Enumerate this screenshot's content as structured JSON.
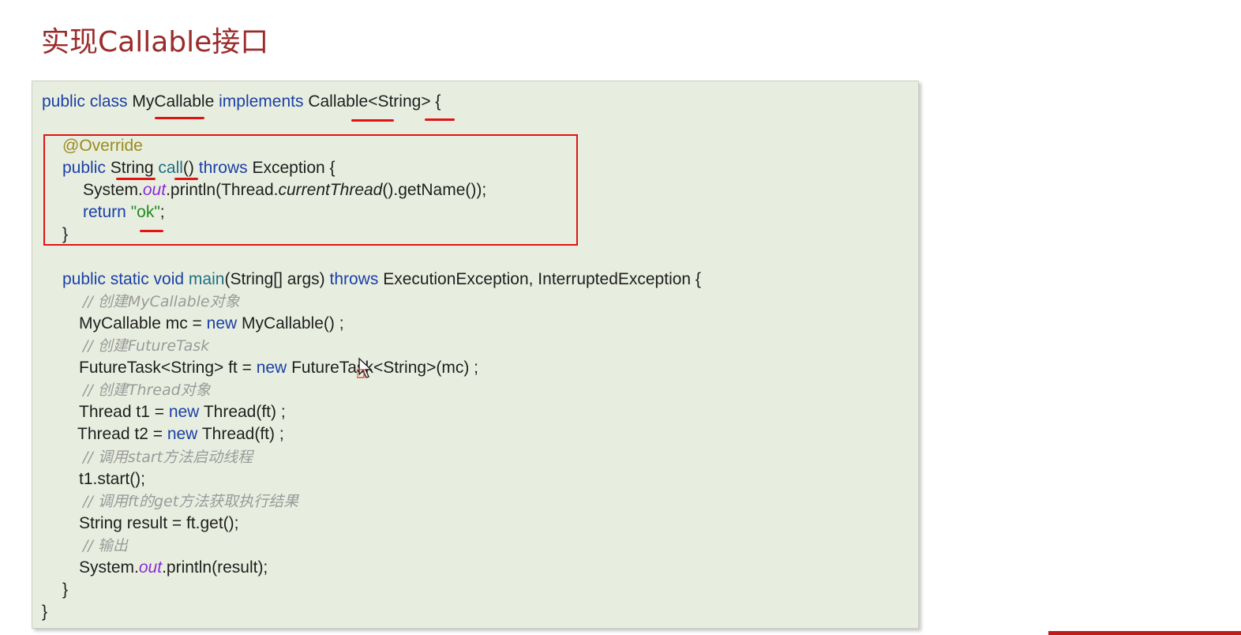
{
  "slide": {
    "title": "实现Callable接口"
  },
  "code": {
    "line1": {
      "kw1": "public class ",
      "name": "MyCallable",
      "kw2": " implements ",
      "type": "Callable",
      "generic": "<String>",
      "tail": " {"
    },
    "line2": {
      "annotation": "@Override"
    },
    "line3": {
      "kw1": "public ",
      "rtype": "String",
      "sp": " ",
      "method": "call",
      "params": "()",
      "kw2": " throws ",
      "exc": "Exception {"
    },
    "line4": {
      "a": "System.",
      "field": "out",
      "b": ".println(Thread.",
      "c": "currentThread",
      "d": "().getName());"
    },
    "line5": {
      "kw": "return ",
      "str": "\"ok\"",
      "tail": ";"
    },
    "line6": {
      "text": "}"
    },
    "line7": {
      "kw1": "public static void ",
      "method": "main",
      "a": "(String[] args) ",
      "kw2": "throws",
      "b": " ExecutionException, InterruptedException {"
    },
    "line8": {
      "comment": "// 创建MyCallable对象"
    },
    "line9": {
      "a": "MyCallable mc = ",
      "kw": "new",
      "b": " MyCallable() ;"
    },
    "line10": {
      "comment": "// 创建FutureTask"
    },
    "line11": {
      "a": "FutureTask<String> ft = ",
      "kw": "new",
      "b": " FutureTask<String>(mc) ;"
    },
    "line12": {
      "comment": "// 创建Thread对象"
    },
    "line13": {
      "a": "Thread t1 = ",
      "kw": "new",
      "b": " Thread(ft) ;"
    },
    "line14": {
      "a": "Thread t2 = ",
      "kw": "new",
      "b": " Thread(ft) ;"
    },
    "line15": {
      "comment": "// 调用start方法启动线程"
    },
    "line16": {
      "text": "t1.start();"
    },
    "line17": {
      "comment": "// 调用ft的get方法获取执行结果"
    },
    "line18": {
      "text": "String result = ft.get();"
    },
    "line19": {
      "comment": "// 输出"
    },
    "line20": {
      "a": "System.",
      "field": "out",
      "b": ".println(result);"
    },
    "line21": {
      "text": "}"
    },
    "line22": {
      "text": "}"
    }
  },
  "colors": {
    "title": "#9b2b2b",
    "panel_background": "#e8eedf",
    "keyword": "#1a3fa8",
    "annotation": "#9a8b1c",
    "field": "#8a2bd6",
    "string": "#1f8a1f",
    "comment": "#9a9a9a",
    "highlight_marker": "#e01414"
  },
  "icons": [
    "mouse-cursor-icon"
  ]
}
